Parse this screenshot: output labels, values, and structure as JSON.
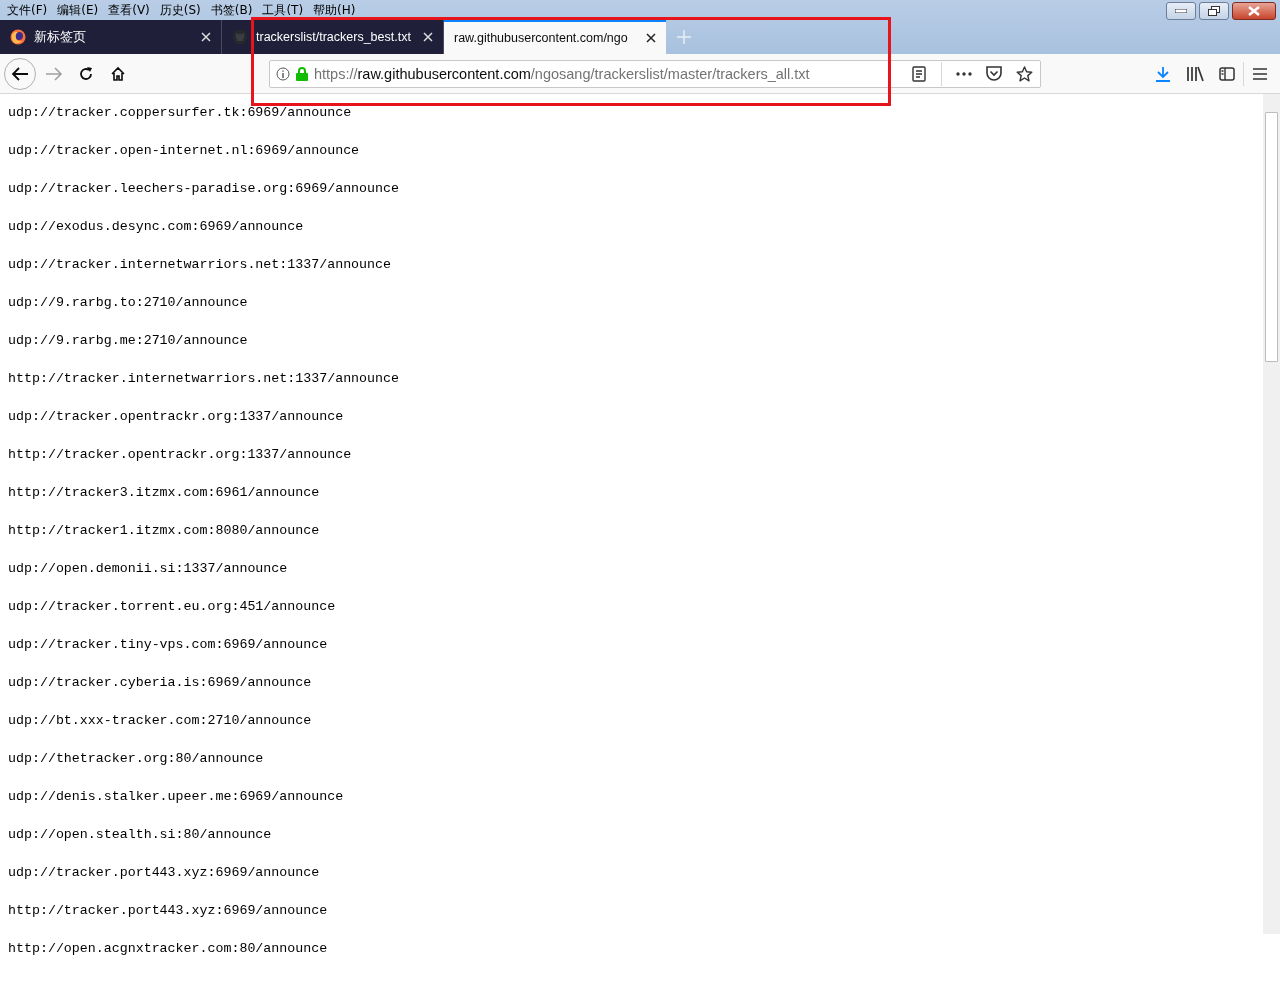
{
  "menu_bar": [
    "文件(F)",
    "编辑(E)",
    "查看(V)",
    "历史(S)",
    "书签(B)",
    "工具(T)",
    "帮助(H)"
  ],
  "tabs": [
    {
      "title": "新标签页",
      "selected": false
    },
    {
      "title": "trackerslist/trackers_best.txt",
      "selected": false
    },
    {
      "title": "raw.githubusercontent.com/ngo",
      "selected": true
    }
  ],
  "address_bar": {
    "scheme": "https://",
    "host": "raw.githubusercontent.com",
    "path": "/ngosang/trackerslist/master/trackers_all.txt"
  },
  "lines": [
    "udp://tracker.coppersurfer.tk:6969/announce",
    "udp://tracker.open-internet.nl:6969/announce",
    "udp://tracker.leechers-paradise.org:6969/announce",
    "udp://exodus.desync.com:6969/announce",
    "udp://tracker.internetwarriors.net:1337/announce",
    "udp://9.rarbg.to:2710/announce",
    "udp://9.rarbg.me:2710/announce",
    "http://tracker.internetwarriors.net:1337/announce",
    "udp://tracker.opentrackr.org:1337/announce",
    "http://tracker.opentrackr.org:1337/announce",
    "http://tracker3.itzmx.com:6961/announce",
    "http://tracker1.itzmx.com:8080/announce",
    "udp://open.demonii.si:1337/announce",
    "udp://tracker.torrent.eu.org:451/announce",
    "udp://tracker.tiny-vps.com:6969/announce",
    "udp://tracker.cyberia.is:6969/announce",
    "udp://bt.xxx-tracker.com:2710/announce",
    "udp://thetracker.org:80/announce",
    "udp://denis.stalker.upeer.me:6969/announce",
    "udp://open.stealth.si:80/announce",
    "udp://tracker.port443.xyz:6969/announce",
    "http://tracker.port443.xyz:6969/announce",
    "http://open.acgnxtracker.com:80/announce"
  ]
}
